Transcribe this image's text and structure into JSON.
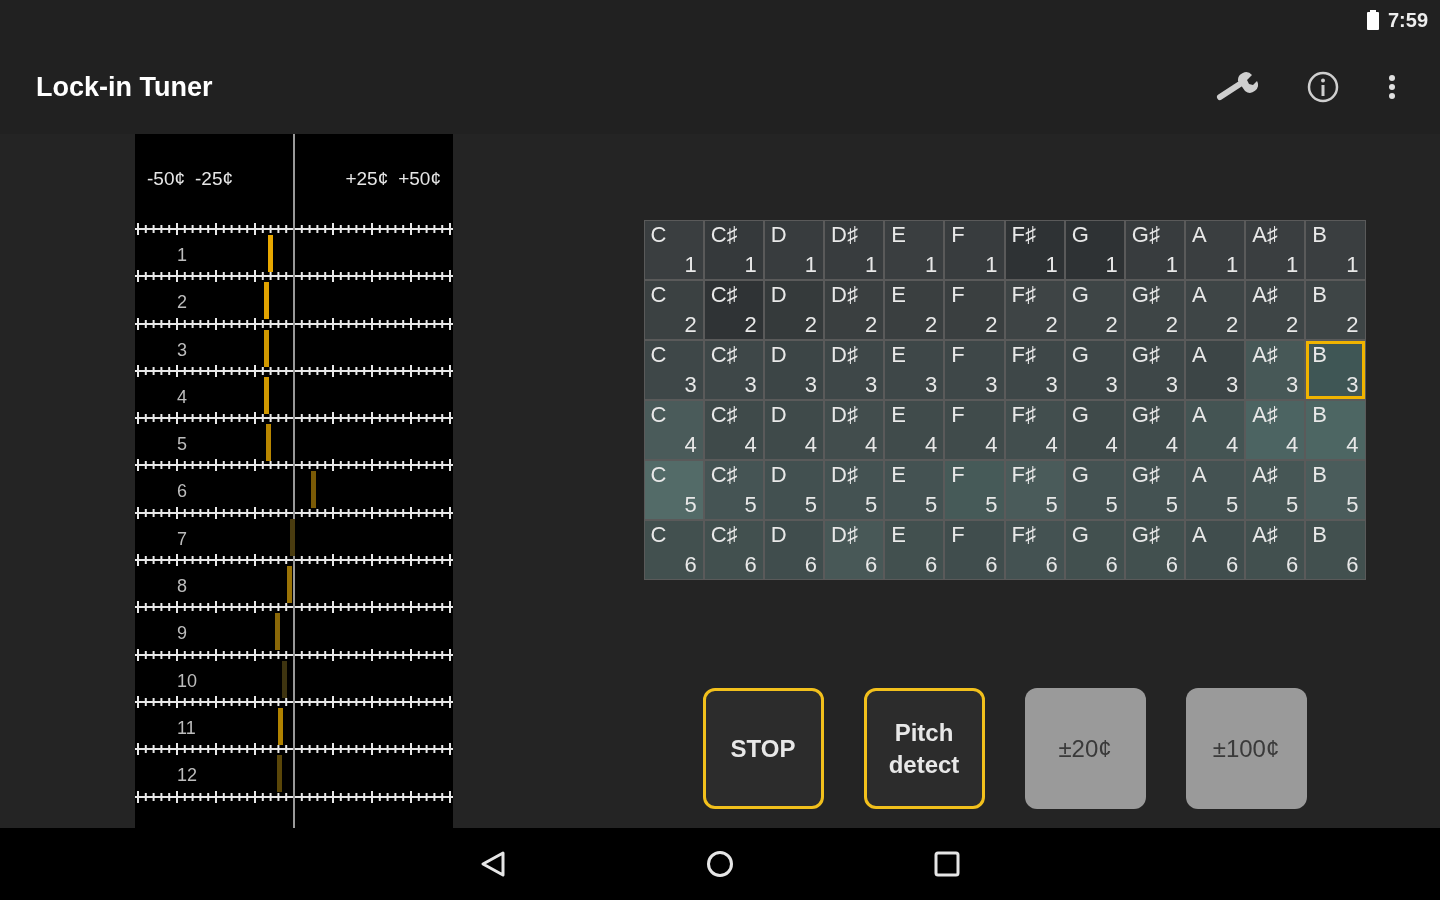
{
  "status_bar": {
    "time": "7:59"
  },
  "app_bar": {
    "title": "Lock-in Tuner"
  },
  "strip": {
    "scale_labels": [
      "-50¢",
      "-25¢",
      "+25¢",
      "+50¢"
    ],
    "lanes": [
      {
        "label": "1",
        "level": 0.425,
        "color": "#e8a800"
      },
      {
        "label": "2",
        "level": 0.413,
        "color": "#e0a200"
      },
      {
        "label": "3",
        "level": 0.413,
        "color": "#d09800"
      },
      {
        "label": "4",
        "level": 0.413,
        "color": "#d09800"
      },
      {
        "label": "5",
        "level": 0.418,
        "color": "#b88600"
      },
      {
        "label": "6",
        "level": 0.56,
        "color": "#7a5a06"
      },
      {
        "label": "7",
        "level": 0.494,
        "color": "#4a3c10"
      },
      {
        "label": "8",
        "level": 0.484,
        "color": "#9a7306"
      },
      {
        "label": "9",
        "level": 0.447,
        "color": "#8a6808"
      },
      {
        "label": "10",
        "level": 0.47,
        "color": "#3e3410"
      },
      {
        "label": "11",
        "level": 0.456,
        "color": "#b08200"
      },
      {
        "label": "12",
        "level": 0.453,
        "color": "#5a4608"
      }
    ]
  },
  "note_grid": {
    "rows": [
      {
        "cells": [
          {
            "note": "C",
            "octave": "1",
            "color": "#3a3e40",
            "selected": false
          },
          {
            "note": "C♯",
            "octave": "1",
            "color": "#35393b",
            "selected": false
          },
          {
            "note": "D",
            "octave": "1",
            "color": "#383c3e",
            "selected": false
          },
          {
            "note": "D♯",
            "octave": "1",
            "color": "#383c3e",
            "selected": false
          },
          {
            "note": "E",
            "octave": "1",
            "color": "#3a3e40",
            "selected": false
          },
          {
            "note": "F",
            "octave": "1",
            "color": "#383c3e",
            "selected": false
          },
          {
            "note": "F♯",
            "octave": "1",
            "color": "#2e3234",
            "selected": false
          },
          {
            "note": "G",
            "octave": "1",
            "color": "#2e3234",
            "selected": false
          },
          {
            "note": "G♯",
            "octave": "1",
            "color": "#383c3e",
            "selected": false
          },
          {
            "note": "A",
            "octave": "1",
            "color": "#3a3e40",
            "selected": false
          },
          {
            "note": "A♯",
            "octave": "1",
            "color": "#3a3e40",
            "selected": false
          },
          {
            "note": "B",
            "octave": "1",
            "color": "#3a3e40",
            "selected": false
          }
        ]
      },
      {
        "cells": [
          {
            "note": "C",
            "octave": "2",
            "color": "#3b4142",
            "selected": false
          },
          {
            "note": "C♯",
            "octave": "2",
            "color": "#2f3335",
            "selected": false
          },
          {
            "note": "D",
            "octave": "2",
            "color": "#353a3b",
            "selected": false
          },
          {
            "note": "D♯",
            "octave": "2",
            "color": "#3a3f40",
            "selected": false
          },
          {
            "note": "E",
            "octave": "2",
            "color": "#3a3f40",
            "selected": false
          },
          {
            "note": "F",
            "octave": "2",
            "color": "#3a3f40",
            "selected": false
          },
          {
            "note": "F♯",
            "octave": "2",
            "color": "#3e4445",
            "selected": false
          },
          {
            "note": "G",
            "octave": "2",
            "color": "#3e4546",
            "selected": false
          },
          {
            "note": "G♯",
            "octave": "2",
            "color": "#3e4546",
            "selected": false
          },
          {
            "note": "A",
            "octave": "2",
            "color": "#3e4546",
            "selected": false
          },
          {
            "note": "A♯",
            "octave": "2",
            "color": "#3e4546",
            "selected": false
          },
          {
            "note": "B",
            "octave": "2",
            "color": "#3e4546",
            "selected": false
          }
        ]
      },
      {
        "cells": [
          {
            "note": "C",
            "octave": "3",
            "color": "#3e4748",
            "selected": false
          },
          {
            "note": "C♯",
            "octave": "3",
            "color": "#3e4748",
            "selected": false
          },
          {
            "note": "D",
            "octave": "3",
            "color": "#3c4546",
            "selected": false
          },
          {
            "note": "D♯",
            "octave": "3",
            "color": "#3e4748",
            "selected": false
          },
          {
            "note": "E",
            "octave": "3",
            "color": "#3e4748",
            "selected": false
          },
          {
            "note": "F",
            "octave": "3",
            "color": "#3e4748",
            "selected": false
          },
          {
            "note": "F♯",
            "octave": "3",
            "color": "#3e4748",
            "selected": false
          },
          {
            "note": "G",
            "octave": "3",
            "color": "#3e4748",
            "selected": false
          },
          {
            "note": "G♯",
            "octave": "3",
            "color": "#3e4748",
            "selected": false
          },
          {
            "note": "A",
            "octave": "3",
            "color": "#3c4546",
            "selected": false
          },
          {
            "note": "A♯",
            "octave": "3",
            "color": "#475857",
            "selected": false
          },
          {
            "note": "B",
            "octave": "3",
            "color": "#3f5655",
            "selected": true
          }
        ]
      },
      {
        "cells": [
          {
            "note": "C",
            "octave": "4",
            "color": "#4a5b5a",
            "selected": false
          },
          {
            "note": "C♯",
            "octave": "4",
            "color": "#3f4a4a",
            "selected": false
          },
          {
            "note": "D",
            "octave": "4",
            "color": "#3f4a4a",
            "selected": false
          },
          {
            "note": "D♯",
            "octave": "4",
            "color": "#424d4d",
            "selected": false
          },
          {
            "note": "E",
            "octave": "4",
            "color": "#404b4b",
            "selected": false
          },
          {
            "note": "F",
            "octave": "4",
            "color": "#404b4b",
            "selected": false
          },
          {
            "note": "F♯",
            "octave": "4",
            "color": "#424e4e",
            "selected": false
          },
          {
            "note": "G",
            "octave": "4",
            "color": "#3f4a4a",
            "selected": false
          },
          {
            "note": "G♯",
            "octave": "4",
            "color": "#404c4c",
            "selected": false
          },
          {
            "note": "A",
            "octave": "4",
            "color": "#445453",
            "selected": false
          },
          {
            "note": "A♯",
            "octave": "4",
            "color": "#4c6462",
            "selected": false
          },
          {
            "note": "B",
            "octave": "4",
            "color": "#4d6663",
            "selected": false
          }
        ]
      },
      {
        "cells": [
          {
            "note": "C",
            "octave": "5",
            "color": "#536b68",
            "selected": false
          },
          {
            "note": "C♯",
            "octave": "5",
            "color": "#455454",
            "selected": false
          },
          {
            "note": "D",
            "octave": "5",
            "color": "#425050",
            "selected": false
          },
          {
            "note": "D♯",
            "octave": "5",
            "color": "#445252",
            "selected": false
          },
          {
            "note": "E",
            "octave": "5",
            "color": "#445252",
            "selected": false
          },
          {
            "note": "F",
            "octave": "5",
            "color": "#465a58",
            "selected": false
          },
          {
            "note": "F♯",
            "octave": "5",
            "color": "#4a5b5a",
            "selected": false
          },
          {
            "note": "G",
            "octave": "5",
            "color": "#445252",
            "selected": false
          },
          {
            "note": "G♯",
            "octave": "5",
            "color": "#445252",
            "selected": false
          },
          {
            "note": "A",
            "octave": "5",
            "color": "#445252",
            "selected": false
          },
          {
            "note": "A♯",
            "octave": "5",
            "color": "#465655",
            "selected": false
          },
          {
            "note": "B",
            "octave": "5",
            "color": "#4a5c5b",
            "selected": false
          }
        ]
      },
      {
        "cells": [
          {
            "note": "C",
            "octave": "6",
            "color": "#42504f",
            "selected": false
          },
          {
            "note": "C♯",
            "octave": "6",
            "color": "#42504f",
            "selected": false
          },
          {
            "note": "D",
            "octave": "6",
            "color": "#404d4d",
            "selected": false
          },
          {
            "note": "D♯",
            "octave": "6",
            "color": "#485857",
            "selected": false
          },
          {
            "note": "E",
            "octave": "6",
            "color": "#42504f",
            "selected": false
          },
          {
            "note": "F",
            "octave": "6",
            "color": "#404d4d",
            "selected": false
          },
          {
            "note": "F♯",
            "octave": "6",
            "color": "#445252",
            "selected": false
          },
          {
            "note": "G",
            "octave": "6",
            "color": "#42504f",
            "selected": false
          },
          {
            "note": "G♯",
            "octave": "6",
            "color": "#42504f",
            "selected": false
          },
          {
            "note": "A",
            "octave": "6",
            "color": "#404d4d",
            "selected": false
          },
          {
            "note": "A♯",
            "octave": "6",
            "color": "#42504f",
            "selected": false
          },
          {
            "note": "B",
            "octave": "6",
            "color": "#42504f",
            "selected": false
          }
        ]
      }
    ]
  },
  "buttons": [
    {
      "label": "STOP",
      "active": true
    },
    {
      "label": "Pitch detect",
      "active": true
    },
    {
      "label": "±20¢",
      "active": false
    },
    {
      "label": "±100¢",
      "active": false
    }
  ]
}
